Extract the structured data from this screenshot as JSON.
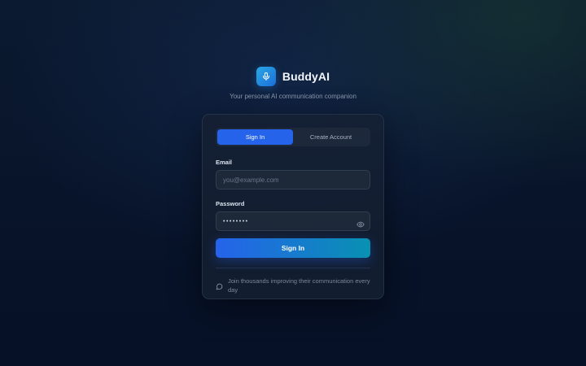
{
  "brand": {
    "name": "BuddyAI",
    "icon": "microphone-icon",
    "tagline": "Your personal AI communication companion",
    "accent": "#1b6fd8"
  },
  "tabs": [
    {
      "label": "Sign In",
      "active": true
    },
    {
      "label": "Create Account",
      "active": false
    }
  ],
  "form": {
    "email": {
      "label": "Email",
      "placeholder": "you@example.com",
      "value": ""
    },
    "password": {
      "label": "Password",
      "value": "••••••••",
      "toggle_icon": "eye-icon"
    },
    "submit_label": "Sign In"
  },
  "footer": {
    "icon": "chat-bubble-icon",
    "text": "Join thousands improving their communication every day"
  },
  "colors": {
    "primary": "#2563eb",
    "secondary": "#0891b2",
    "card_bg": "#162032"
  }
}
